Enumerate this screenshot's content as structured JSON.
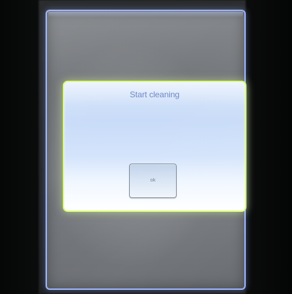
{
  "dialog": {
    "title": "Start cleaning",
    "ok_label": "ok"
  },
  "colors": {
    "screen_border": "#9cb4ff",
    "dialog_border": "#d9ff76",
    "title_text": "#6f87c9"
  }
}
